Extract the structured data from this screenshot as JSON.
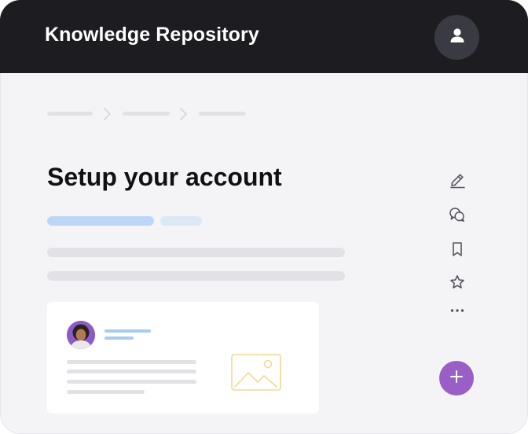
{
  "app": {
    "title": "Knowledge Repository"
  },
  "page": {
    "title": "Setup your account"
  },
  "icons": {
    "profile": "user-icon",
    "edit": "pencil-icon",
    "comment": "chat-bubble-icon",
    "bookmark": "bookmark-icon",
    "favorite": "star-icon",
    "more": "more-horizontal-icon",
    "add": "plus-icon",
    "image": "image-placeholder-icon"
  },
  "colors": {
    "header_bg": "#1c1c21",
    "page_bg": "#f4f4f6",
    "accent_purple": "#9a5fc6",
    "tag_blue": "#bcd6f6",
    "placeholder_gray": "#e2e2e6",
    "image_placeholder": "#f3d98f"
  }
}
